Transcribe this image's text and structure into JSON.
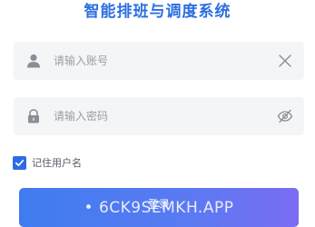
{
  "title": "智能排班与调度系统",
  "account": {
    "placeholder": "请输入账号",
    "icon": "user-icon",
    "clear_icon": "clear-icon"
  },
  "password": {
    "placeholder": "请输入密码",
    "icon": "lock-icon",
    "toggle_icon": "eye-off-icon"
  },
  "remember": {
    "label": "记住用户名",
    "checked": true
  },
  "login": {
    "label": "登录",
    "watermark": "• 6CK9SEMKH.APP"
  },
  "colors": {
    "title": "#2c6fe0",
    "field_bg": "#f4f5f7",
    "checkbox": "#2e6be6",
    "button_start": "#3f7cf0",
    "button_end": "#7a6cf3"
  }
}
